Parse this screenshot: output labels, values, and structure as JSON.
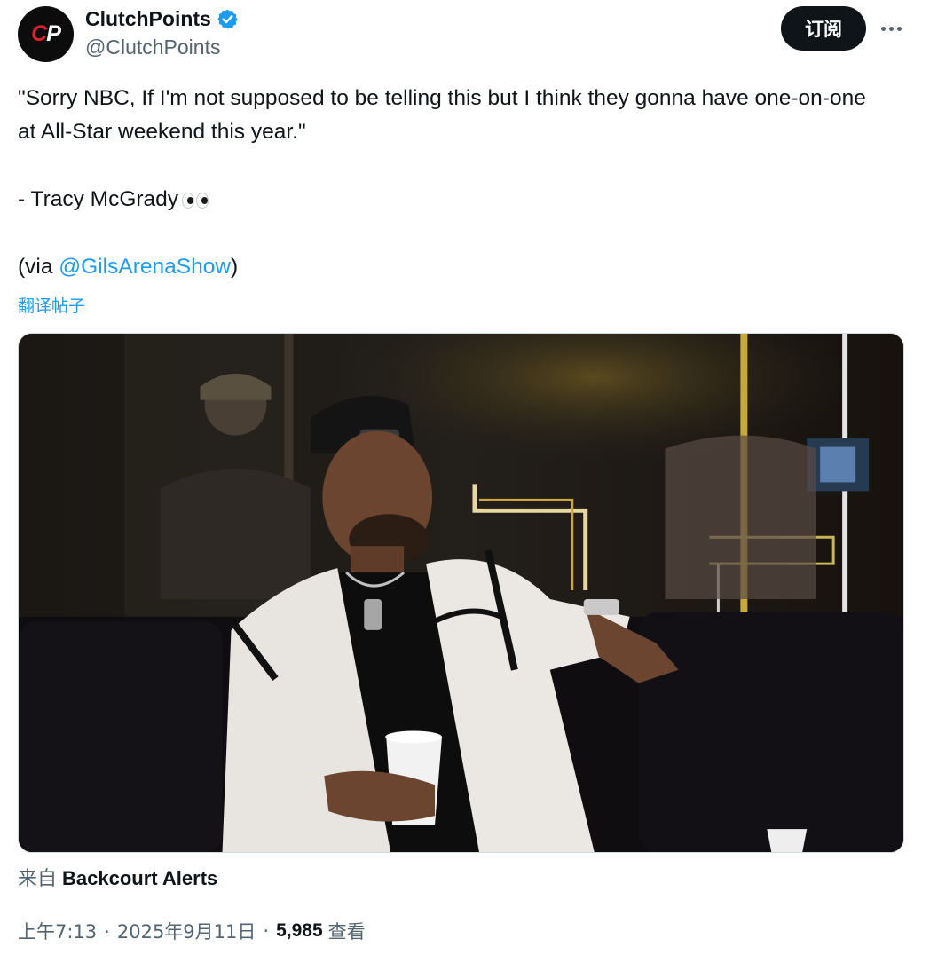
{
  "author": {
    "avatar_icon": "clutchpoints-logo",
    "display_name": "ClutchPoints",
    "verified_icon": "verified-badge-icon",
    "handle": "@ClutchPoints"
  },
  "actions": {
    "subscribe_label": "订阅",
    "more_icon": "more-horizontal-icon"
  },
  "tweet": {
    "quote": "\"Sorry NBC, If I'm not supposed to be telling this but I think they gonna have one-on-one at All-Star weekend this year.\"",
    "attribution": "- Tracy McGrady",
    "attribution_emoji": "eyes-emoji-icon",
    "via_prefix": "(via ",
    "via_mention": "@GilsArenaShow",
    "via_suffix": ")",
    "translate_label": "翻译帖子"
  },
  "media": {
    "type": "video",
    "icon": "video-thumbnail"
  },
  "source": {
    "prefix": "来自",
    "name": "Backcourt Alerts"
  },
  "meta": {
    "time": "上午7:13",
    "date": "2025年9月11日",
    "separator": "·",
    "views_count": "5,985",
    "views_label": "查看"
  },
  "colors": {
    "accent": "#1d9bf0",
    "text_primary": "#0f1419",
    "text_secondary": "#536471",
    "button_bg": "#0f1419"
  }
}
